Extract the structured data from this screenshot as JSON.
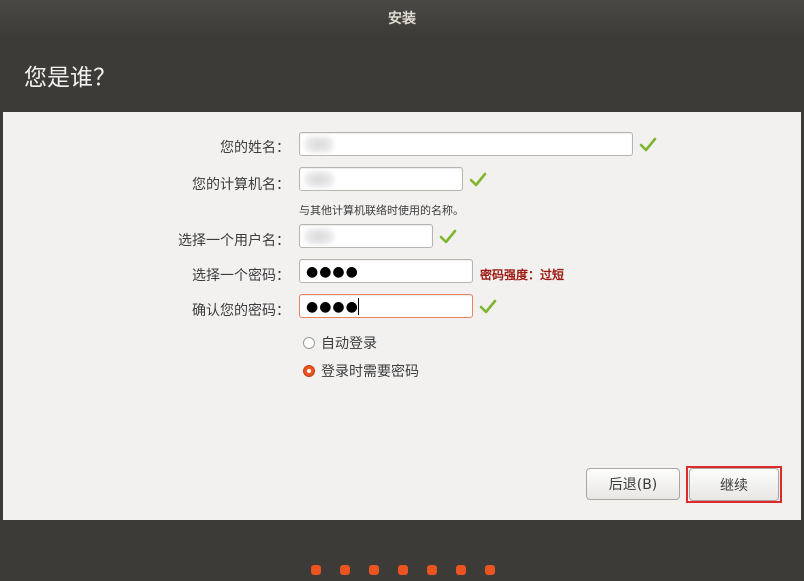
{
  "window": {
    "title": "安装"
  },
  "header": {
    "title": "您是谁？"
  },
  "form": {
    "name_label": "您的姓名：",
    "computer_label": "您的计算机名：",
    "computer_hint": "与其他计算机联络时使用的名称。",
    "username_label": "选择一个用户名：",
    "password_label": "选择一个密码：",
    "password_value": "●●●●",
    "password_strength": "密码强度：过短",
    "confirm_label": "确认您的密码：",
    "confirm_value": "●●●●"
  },
  "login_options": [
    {
      "label": "自动登录",
      "selected": false
    },
    {
      "label": "登录时需要密码",
      "selected": true
    }
  ],
  "buttons": {
    "back": "后退(B)",
    "continue": "继续"
  },
  "progress": {
    "total_steps": 7
  },
  "colors": {
    "accent": "#e95420",
    "check": "#7fb62e",
    "error": "#9c1a12",
    "highlight": "#e02a2a"
  }
}
